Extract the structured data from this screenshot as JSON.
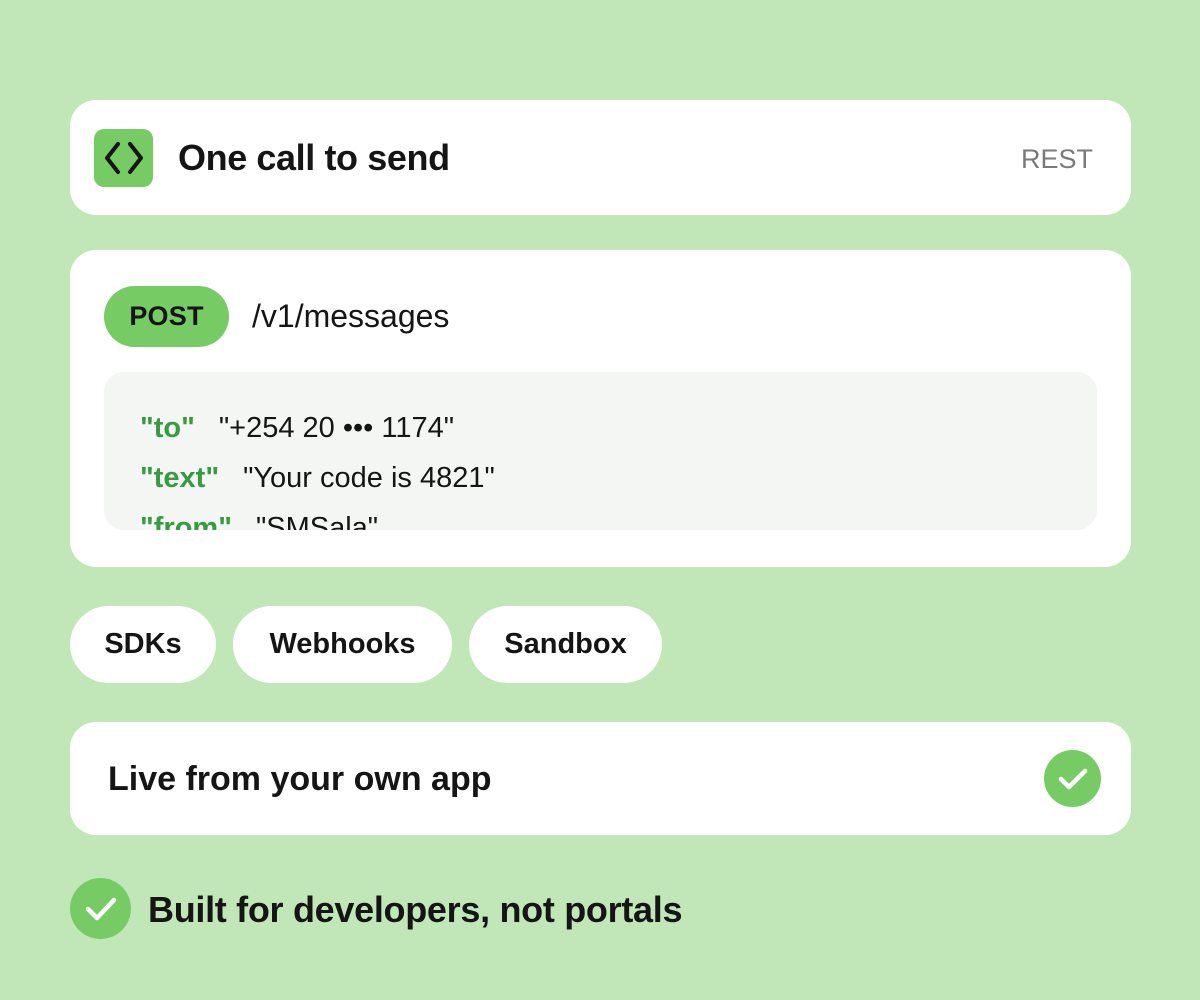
{
  "header": {
    "icon": "code-brackets-icon",
    "title": "One call to send",
    "tag": "REST"
  },
  "request": {
    "method": "POST",
    "endpoint": "/v1/messages",
    "fields": [
      {
        "key": "\"to\"",
        "value": "\"+254 20 ••• 1174\""
      },
      {
        "key": "\"text\"",
        "value": "\"Your code is 4821\""
      },
      {
        "key": "\"from\"",
        "value": "\"SMSala\""
      }
    ]
  },
  "features": [
    "SDKs",
    "Webhooks",
    "Sandbox"
  ],
  "status": {
    "text": "Live from your own app",
    "icon": "check-icon"
  },
  "footer": {
    "text": "Built for developers, not portals",
    "icon": "check-icon"
  },
  "colors": {
    "background": "#c1e7b9",
    "accent": "#76cb64",
    "key": "#389a42",
    "card": "#ffffff",
    "code_bg": "#f3f6f2"
  }
}
